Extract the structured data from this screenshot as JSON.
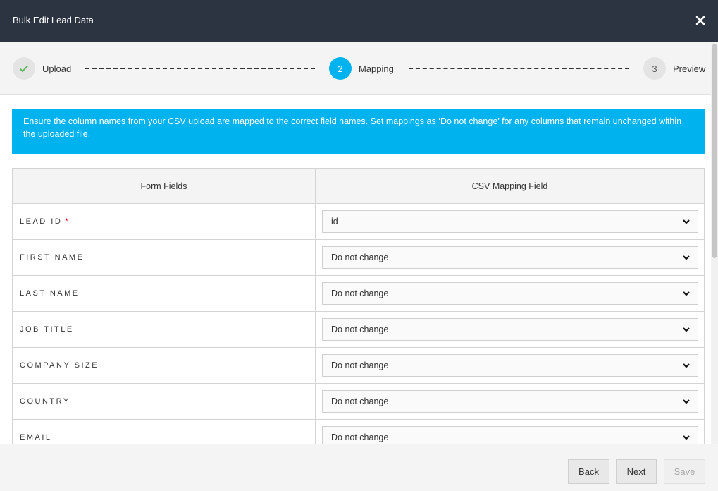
{
  "dialog": {
    "title": "Bulk Edit Lead Data"
  },
  "steps": [
    {
      "number": "",
      "label": "Upload",
      "state": "done"
    },
    {
      "number": "2",
      "label": "Mapping",
      "state": "active"
    },
    {
      "number": "3",
      "label": "Preview",
      "state": "pending"
    }
  ],
  "info_text": "Ensure the column names from your CSV upload are mapped to the correct field names. Set mappings as ‘Do not change’ for any columns that remain unchanged within the uploaded file.",
  "table": {
    "headers": [
      "Form Fields",
      "CSV Mapping Field"
    ],
    "rows": [
      {
        "field": "LEAD ID",
        "required": "*",
        "mapping": "id"
      },
      {
        "field": "FIRST NAME",
        "mapping": "Do not change"
      },
      {
        "field": "LAST NAME",
        "mapping": "Do not change"
      },
      {
        "field": "JOB TITLE",
        "mapping": "Do not change"
      },
      {
        "field": "COMPANY SIZE",
        "mapping": "Do not change"
      },
      {
        "field": "COUNTRY",
        "mapping": "Do not change"
      },
      {
        "field": "EMAIL",
        "mapping": "Do not change"
      }
    ]
  },
  "buttons": {
    "back": "Back",
    "next": "Next",
    "save": "Save"
  },
  "icons": {
    "close": "close-icon",
    "step_done": "checkmark-icon",
    "select": "chevron-down-icon"
  },
  "colors": {
    "titlebar": "#2b3440",
    "accent": "#00b3ef",
    "check": "#5cb85c",
    "required": "#d0021b"
  }
}
